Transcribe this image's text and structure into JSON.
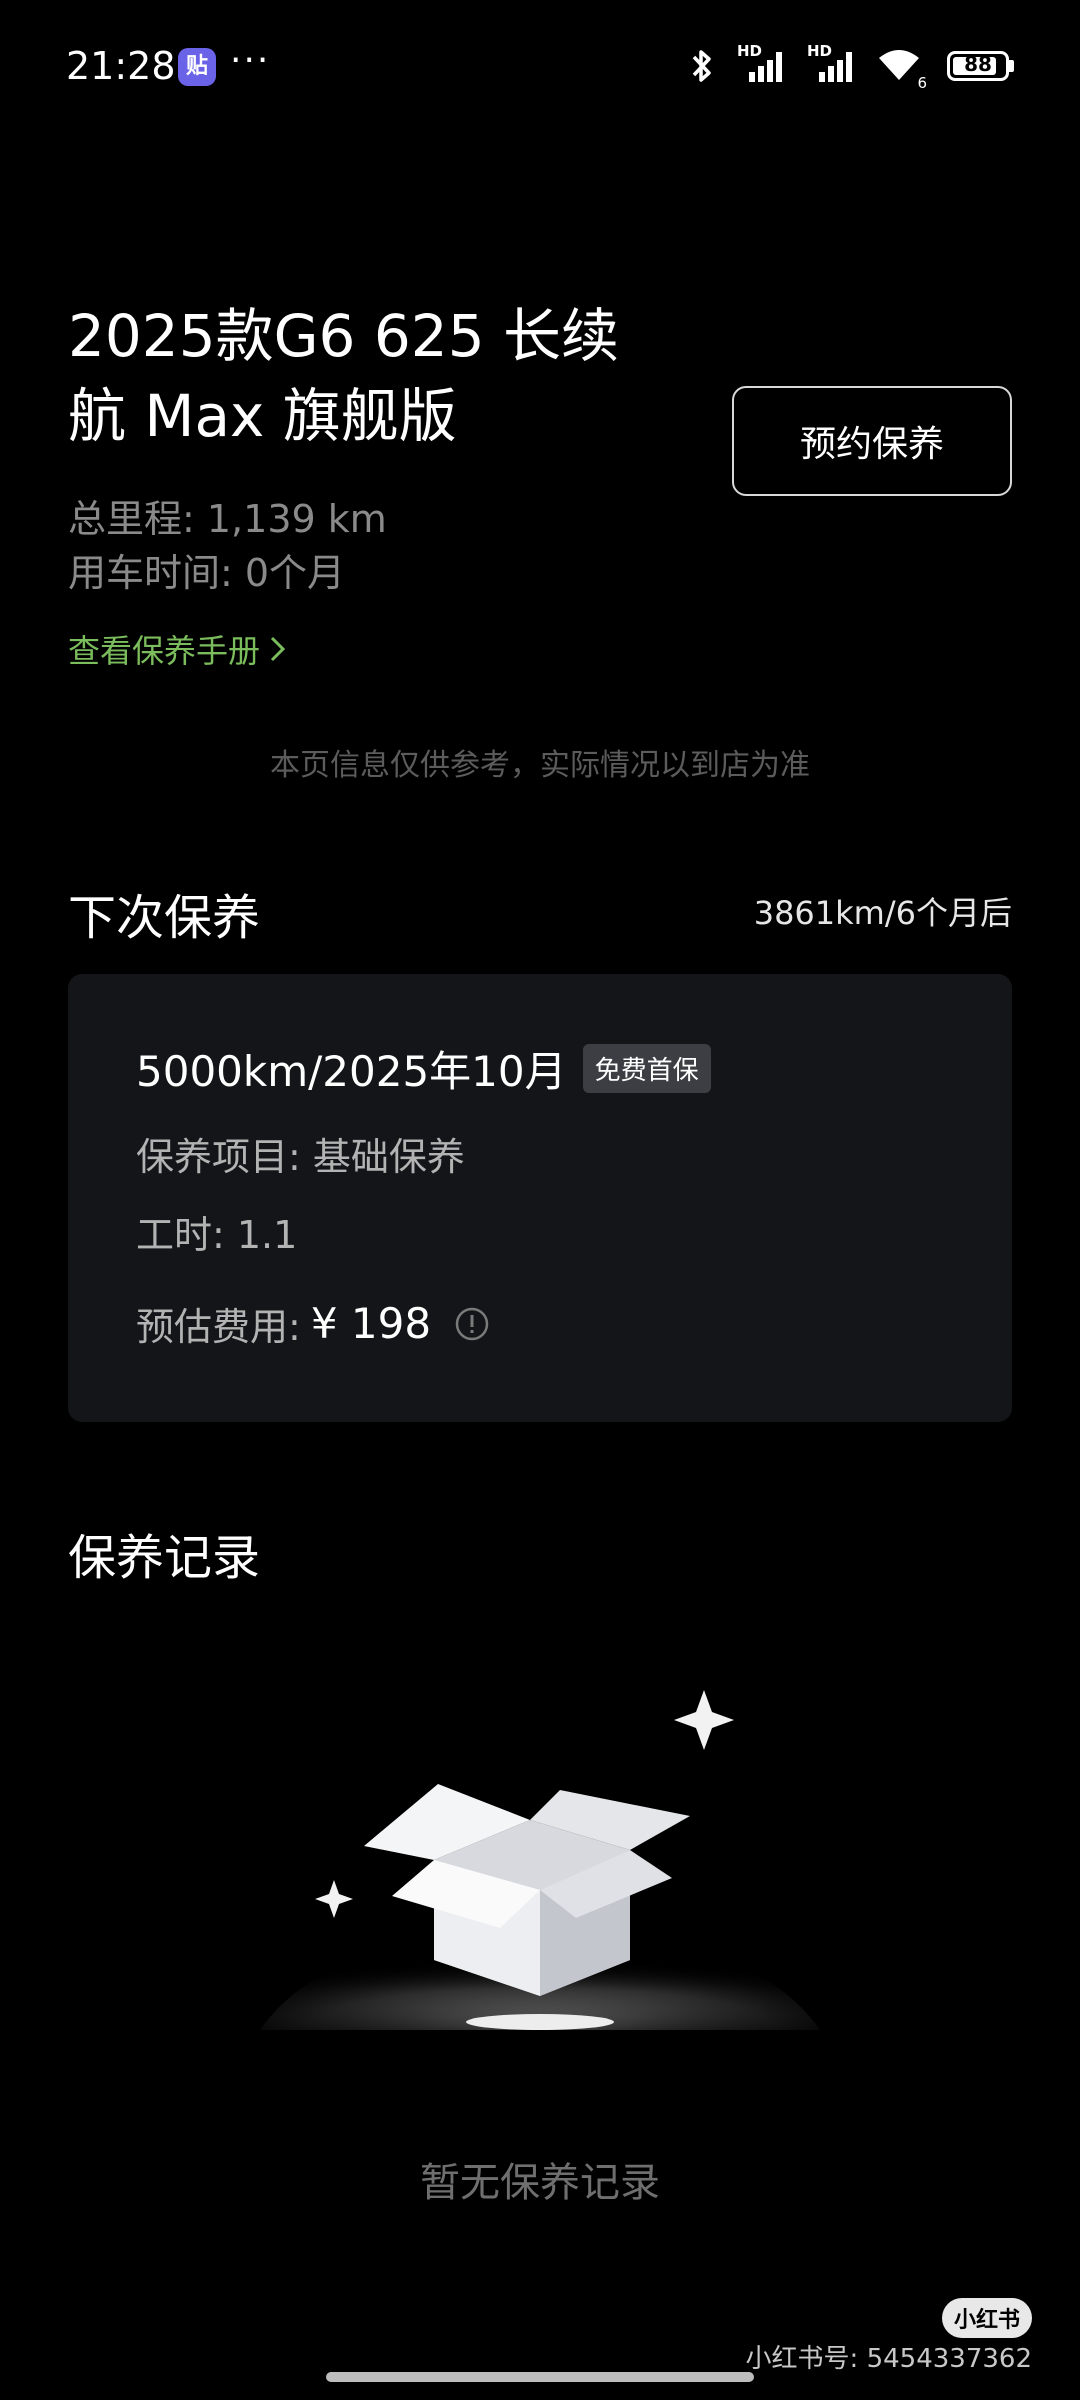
{
  "status_bar": {
    "time": "21:28",
    "app_badge": "贴",
    "more": "···",
    "battery": "88",
    "battery_level": 0.88,
    "signal1_label": "HD",
    "signal2_label": "HD",
    "wifi_label": "6",
    "icons": [
      "bluetooth-icon",
      "signal-icon",
      "signal-icon",
      "wifi-icon",
      "battery-icon"
    ]
  },
  "vehicle": {
    "title": "2025款G6 625 长续航 Max 旗舰版",
    "mileage": "总里程: 1,139 km",
    "usage_time": "用车时间: 0个月",
    "manual_link": "查看保养手册",
    "book_button": "预约保养"
  },
  "disclaimer": "本页信息仅供参考，实际情况以到店为准",
  "next_maintenance": {
    "section_title": "下次保养",
    "remaining": "3861km/6个月后",
    "date": "5000km/2025年10月",
    "tag": "免费首保",
    "items": "保养项目: 基础保养",
    "labor_hours": "工时: 1.1",
    "cost_label": "预估费用:",
    "cost_value": "¥ 198"
  },
  "records": {
    "section_title": "保养记录",
    "empty_text": "暂无保养记录"
  },
  "watermark": {
    "logo": "小红书",
    "id": "小红书号: 5454337362"
  },
  "colors": {
    "background": "#000000",
    "card": "#141518",
    "link_green": "#7bbd5c",
    "muted": "#8a8a8a"
  }
}
